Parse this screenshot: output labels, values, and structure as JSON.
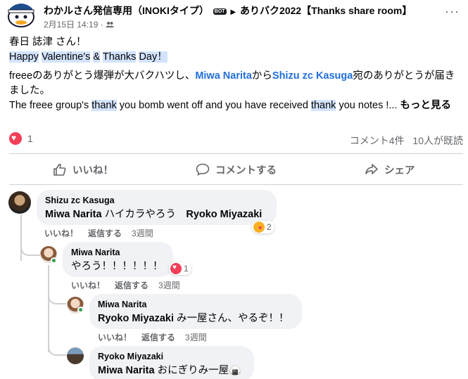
{
  "header": {
    "title": "わかルさん発信専用（INOKIタイプ）",
    "bot_badge": "BOT",
    "group_name": "ありバク2022【Thanks share room】",
    "date": "2月15日 14:19",
    "separator": "·",
    "audience_icon": "group-audience-icon",
    "more": "···"
  },
  "post": {
    "greeting": "春日 誌津 さん！",
    "hl_part1": "Happy",
    "hl_part2": "Valentine's",
    "hl_amp": "&",
    "hl_part3": "Thanks",
    "hl_part4": "Day",
    "hl_bang": "！",
    "jp_line_prefix": "freeeのありがとう爆弾が大バクハツし、",
    "mention_1": "Miwa Narita",
    "from_text": "から",
    "mention_2": "Shizu zc Kasuga",
    "jp_line_suffix": "宛のありがとうが届きました。",
    "en_part1": "The freee group's",
    "en_thank1": "thank",
    "en_part2": "you bomb went off and you have received",
    "en_thank2": "thank",
    "en_part3": "you notes !...",
    "see_more": "もっと見る"
  },
  "reactions": {
    "count": "1",
    "comments": "コメント4件",
    "seen": "10人が既読"
  },
  "actions": {
    "like": "いいね！",
    "comment": "コメントする",
    "share": "シェア"
  },
  "comments": [
    {
      "author": "Shizu zc Kasuga",
      "mention": "Miwa Narita",
      "text": " ハイカラやろう　",
      "mention2": "Ryoko Miyazaki",
      "like": "いいね！",
      "reply": "返信する",
      "time": "3週間",
      "reaction_count": "2"
    },
    {
      "author": "Miwa Narita",
      "text": "やろう！！！！！！",
      "like": "いいね！",
      "reply": "返信する",
      "time": "3週間",
      "reaction_count": "1"
    },
    {
      "author": "Miwa Narita",
      "mention": "Ryoko Miyazaki",
      "text": " み一屋さん、やるぞ！！",
      "like": "いいね！",
      "reply": "返信する",
      "time": "3週間"
    },
    {
      "author": "Ryoko Miyazaki",
      "mention": "Miwa Narita",
      "text": " おにぎりみ一屋",
      "emoji": "🍙"
    }
  ],
  "colors": {
    "mention": "#216fdb",
    "highlight": "#d3e3fd",
    "bubble": "#f0f2f5",
    "secondary_text": "#65676b",
    "heart": "#f33e58"
  }
}
